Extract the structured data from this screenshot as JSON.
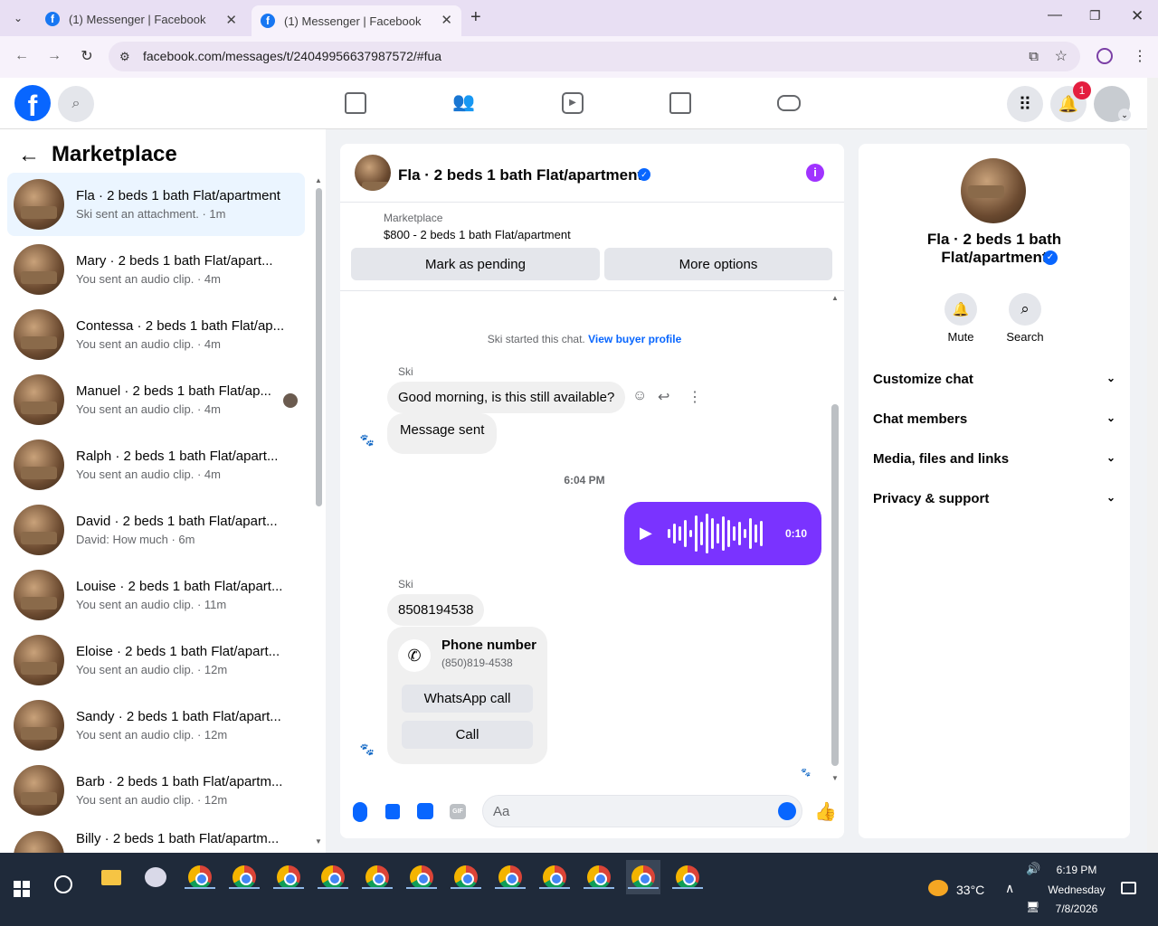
{
  "browser": {
    "tabs": [
      {
        "title": "(1) Messenger | Facebook"
      },
      {
        "title": "(1) Messenger | Facebook"
      }
    ],
    "url": "facebook.com/messages/t/24049956637987572/#fua"
  },
  "fb_header": {
    "notification_count": "1"
  },
  "left": {
    "title": "Marketplace",
    "conversations": [
      {
        "name": "Fla · 2 beds 1 bath Flat/apartment",
        "sub": "Ski sent an attachment. · 1m"
      },
      {
        "name": "Mary · 2 beds 1 bath Flat/apart...",
        "sub": "You sent an audio clip. · 4m"
      },
      {
        "name": "Contessa · 2 beds 1 bath Flat/ap...",
        "sub": "You sent an audio clip. · 4m"
      },
      {
        "name": "Manuel · 2 beds 1 bath Flat/ap...",
        "sub": "You sent an audio clip. · 4m"
      },
      {
        "name": "Ralph · 2 beds 1 bath Flat/apart...",
        "sub": "You sent an audio clip. · 4m"
      },
      {
        "name": "David · 2 beds 1 bath Flat/apart...",
        "sub": "David: How much · 6m"
      },
      {
        "name": "Louise · 2 beds 1 bath Flat/apart...",
        "sub": "You sent an audio clip. · 11m"
      },
      {
        "name": "Eloise · 2 beds 1 bath Flat/apart...",
        "sub": "You sent an audio clip. · 12m"
      },
      {
        "name": "Sandy · 2 beds 1 bath Flat/apart...",
        "sub": "You sent an audio clip. · 12m"
      },
      {
        "name": "Barb · 2 beds 1 bath Flat/apartm...",
        "sub": "You sent an audio clip. · 12m"
      },
      {
        "name": "Billy · 2 beds 1 bath Flat/apartm...",
        "sub": ""
      }
    ]
  },
  "chat": {
    "title": "Fla · 2 beds 1 bath Flat/apartment",
    "listing_label": "Marketplace",
    "listing_text": "$800 - 2 beds 1 bath Flat/apartment",
    "mark_pending": "Mark as pending",
    "more_options": "More options",
    "started": "Ski started this chat.",
    "view_profile": "View buyer profile",
    "sender": "Ski",
    "msg1": "Good morning, is this still available?",
    "msg2": "Message sent",
    "timestamp": "6:04 PM",
    "audio_duration": "0:10",
    "sender2": "Ski",
    "msg3": "8508194538",
    "phone_title": "Phone number",
    "phone_number": "(850)819-4538",
    "whatsapp": "WhatsApp call",
    "call": "Call",
    "input_placeholder": "Aa",
    "gif_label": "GIF"
  },
  "right": {
    "name": "Fla · 2 beds 1 bath Flat/apartment",
    "mute": "Mute",
    "search": "Search",
    "sections": [
      "Customize chat",
      "Chat members",
      "Media, files and links",
      "Privacy & support"
    ]
  },
  "taskbar": {
    "weather": "33°C",
    "time": "6:19 PM",
    "day": "Wednesday",
    "date": "7/8/2026"
  }
}
